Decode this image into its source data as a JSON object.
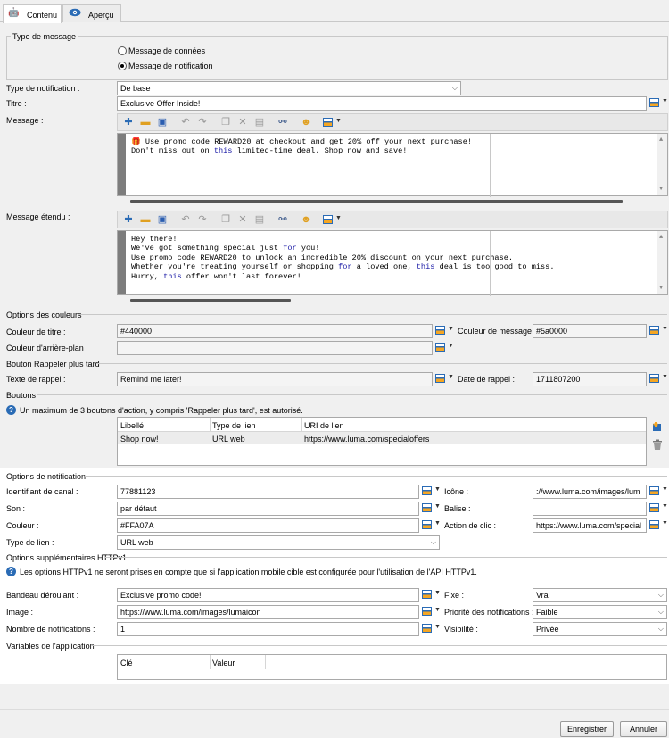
{
  "tabs": [
    {
      "label": "Contenu"
    },
    {
      "label": "Aperçu"
    }
  ],
  "message_type": {
    "group_title": "Type de message",
    "options": [
      {
        "label": "Message de données",
        "selected": false
      },
      {
        "label": "Message de notification",
        "selected": true
      }
    ]
  },
  "notification_type": {
    "label": "Type de notification :",
    "value": "De base"
  },
  "title_field": {
    "label": "Titre :",
    "value": "Exclusive Offer Inside!"
  },
  "message": {
    "label": "Message :",
    "lines": [
      "🎁 Use promo code REWARD20 at checkout and get 20% off your next purchase!",
      "Don't miss out on this limited-time deal. Shop now and save!"
    ]
  },
  "extended_message": {
    "label": "Message étendu :",
    "lines": [
      "Hey there!",
      "We've got something special just for you!",
      "Use promo code REWARD20 to unlock an incredible 20% discount on your next purchase.",
      "Whether you're treating yourself or shopping for a loved one, this deal is too good to miss.",
      "Hurry, this offer won't last forever!"
    ]
  },
  "colors": {
    "group_title": "Options des couleurs",
    "title_color": {
      "label": "Couleur de titre :",
      "value": "#440000"
    },
    "message_color": {
      "label": "Couleur de message :",
      "value": "#5a0000"
    },
    "background_color": {
      "label": "Couleur d'arrière-plan :",
      "value": ""
    }
  },
  "remind_later": {
    "group_title": "Bouton Rappeler plus tard",
    "text": {
      "label": "Texte de rappel :",
      "value": "Remind me later!"
    },
    "date": {
      "label": "Date de rappel :",
      "value": "1711807200"
    }
  },
  "buttons": {
    "group_title": "Boutons",
    "info": "Un maximum de 3 boutons d'action, y compris 'Rappeler plus tard', est autorisé.",
    "columns": [
      "Libellé",
      "Type de lien",
      "URI de lien"
    ],
    "rows": [
      [
        "Shop now!",
        "URL web",
        "https://www.luma.com/specialoffers"
      ]
    ]
  },
  "notification_options": {
    "group_title": "Options de notification",
    "channel_id": {
      "label": "Identifiant de canal :",
      "value": "77881123"
    },
    "icon": {
      "label": "Icône :",
      "value": "://www.luma.com/images/lum"
    },
    "sound": {
      "label": "Son :",
      "value": "par défaut"
    },
    "tag": {
      "label": "Balise :",
      "value": ""
    },
    "color": {
      "label": "Couleur :",
      "value": "#FFA07A"
    },
    "click_action": {
      "label": "Action de clic :",
      "value": "https://www.luma.com/special"
    },
    "link_type": {
      "label": "Type de lien :",
      "value": "URL web"
    }
  },
  "httpv1": {
    "group_title": "Options supplémentaires HTTPv1",
    "info": "Les options HTTPv1 ne seront prises en compte que si l'application mobile cible est configurée pour l'utilisation de l'API HTTPv1.",
    "ticker": {
      "label": "Bandeau déroulant :",
      "value": "Exclusive promo code!"
    },
    "sticky": {
      "label": "Fixe :",
      "value": "Vrai"
    },
    "image": {
      "label": "Image :",
      "value": "https://www.luma.com/images/lumaicon"
    },
    "priority": {
      "label": "Priorité des notifications :",
      "value": "Faible"
    },
    "count": {
      "label": "Nombre de notifications :",
      "value": "1"
    },
    "visibility": {
      "label": "Visibilité :",
      "value": "Privée"
    }
  },
  "app_variables": {
    "group_title": "Variables de l'application",
    "columns": [
      "Clé",
      "Valeur"
    ]
  },
  "footer": {
    "save_label": "Enregistrer",
    "cancel_label": "Annuler"
  },
  "colors_theme": {
    "accent": "#2a6bb5",
    "keyword": "#1a1aa6"
  }
}
